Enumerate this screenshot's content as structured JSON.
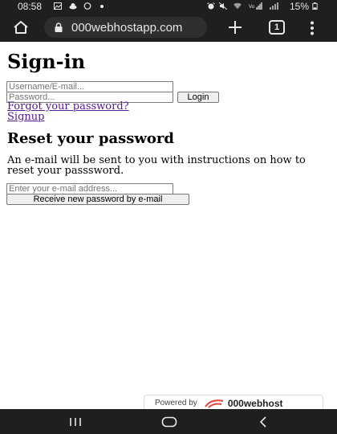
{
  "status_bar": {
    "time": "08:58",
    "battery": "15%",
    "left_icons": [
      "gallery-icon",
      "cloud-icon",
      "whatsapp-icon",
      "dot-icon"
    ],
    "right_icons": [
      "alarm-icon",
      "mute-icon",
      "wifi-icon",
      "volte-signal-icon",
      "signal-icon",
      "battery-icon"
    ]
  },
  "browser": {
    "url": "000webhostapp.com",
    "tab_count": "1"
  },
  "signin": {
    "heading": "Sign-in",
    "username_placeholder": "Username/E-mail...",
    "password_placeholder": "Password...",
    "login_label": "Login",
    "forgot_link": "Forgot your password?",
    "signup_link": "Signup"
  },
  "reset": {
    "heading": "Reset your password",
    "description": "An e-mail will be sent to you with instructions on how to reset your passsword.",
    "email_placeholder": "Enter your e-mail address...",
    "button_label": "Receive new password by e-mail"
  },
  "footer_badge": {
    "powered_label": "Powered by",
    "brand": "000webhost",
    "brand_color": "#e8413c"
  },
  "colors": {
    "chrome_bar": "#1f1f1f",
    "link": "#551a8b"
  }
}
